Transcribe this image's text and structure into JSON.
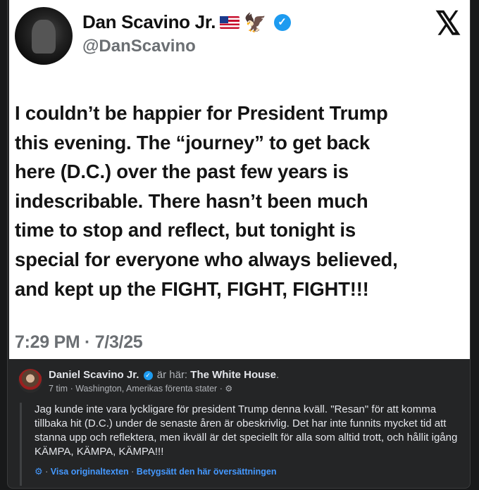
{
  "tweet": {
    "name": "Dan Scavino Jr.",
    "flag_icon": "us-flag-icon",
    "eagle_icon": "eagle-icon",
    "verified_icon": "verified-badge-icon",
    "handle": "@DanScavino",
    "platform_icon": "x-logo-icon",
    "body_lines": [
      "I couldn’t be happier for President Trump",
      "this evening. The “journey” to get back",
      "here (D.C.) over the past few years is",
      "indescribable. There hasn’t been much",
      "time to stop and reflect, but tonight is",
      "special for everyone who always believed,",
      "and kept up the FIGHT, FIGHT, FIGHT!!!"
    ],
    "timestamp": "7:29 PM · 7/3/25"
  },
  "post": {
    "author": "Daniel Scavino Jr.",
    "location_prefix": "är här:",
    "location": "The White House",
    "location_suffix": ".",
    "time": "7 tim",
    "separator1": " · ",
    "place": "Washington, Amerikas förenta stater",
    "separator2": " · ",
    "privacy_icon": "gear-icon",
    "translation": "Jag kunde inte vara lyckligare för president Trump denna kväll. \"Resan\" för att komma tillbaka hit (D.C.) under de senaste åren är obeskrivlig. Det har inte funnits mycket tid att stanna upp och reflektera, men ikväll är det speciellt för alla som alltid trott, och hållit igång KÄMPA, KÄMPA, KÄMPA!!!",
    "link_separator1": " · ",
    "show_original": "Visa originaltexten",
    "link_separator2": " · ",
    "rate_translation": "Betygsätt den här översättningen"
  },
  "colors": {
    "background": "#18191a",
    "card": "#242526",
    "link": "#4599ff",
    "verified": "#1d9bf0"
  }
}
